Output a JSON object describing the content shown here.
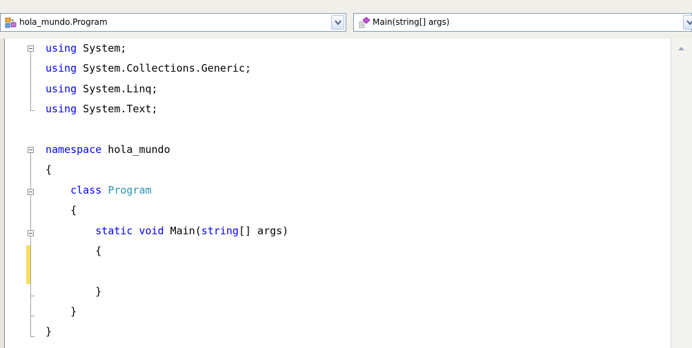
{
  "navigation_bar": {
    "type_combo": {
      "value": "hola_mundo.Program",
      "icon": "class-icon"
    },
    "member_combo": {
      "value": "Main(string[] args)",
      "icon": "method-icon"
    }
  },
  "editor": {
    "language": "C#",
    "lines": [
      [
        {
          "t": "using",
          "c": "kw"
        },
        {
          "t": " System;",
          "c": ""
        }
      ],
      [
        {
          "t": "using",
          "c": "kw"
        },
        {
          "t": " System.Collections.Generic;",
          "c": ""
        }
      ],
      [
        {
          "t": "using",
          "c": "kw"
        },
        {
          "t": " System.Linq;",
          "c": ""
        }
      ],
      [
        {
          "t": "using",
          "c": "kw"
        },
        {
          "t": " System.Text;",
          "c": ""
        }
      ],
      [],
      [
        {
          "t": "namespace",
          "c": "kw"
        },
        {
          "t": " hola_mundo",
          "c": ""
        }
      ],
      [
        {
          "t": "{",
          "c": ""
        }
      ],
      [
        {
          "t": "    ",
          "c": ""
        },
        {
          "t": "class",
          "c": "kw"
        },
        {
          "t": " ",
          "c": ""
        },
        {
          "t": "Program",
          "c": "ty"
        }
      ],
      [
        {
          "t": "    {",
          "c": ""
        }
      ],
      [
        {
          "t": "        ",
          "c": ""
        },
        {
          "t": "static",
          "c": "kw"
        },
        {
          "t": " ",
          "c": ""
        },
        {
          "t": "void",
          "c": "kw"
        },
        {
          "t": " Main(",
          "c": ""
        },
        {
          "t": "string",
          "c": "kw"
        },
        {
          "t": "[] args)",
          "c": ""
        }
      ],
      [
        {
          "t": "        {",
          "c": ""
        }
      ],
      [],
      [
        {
          "t": "        }",
          "c": ""
        }
      ],
      [
        {
          "t": "    }",
          "c": ""
        }
      ],
      [
        {
          "t": "}",
          "c": ""
        }
      ]
    ]
  },
  "colors": {
    "keyword": "#0000ff",
    "type": "#2b91af",
    "change_marker": "#f5de5a"
  }
}
